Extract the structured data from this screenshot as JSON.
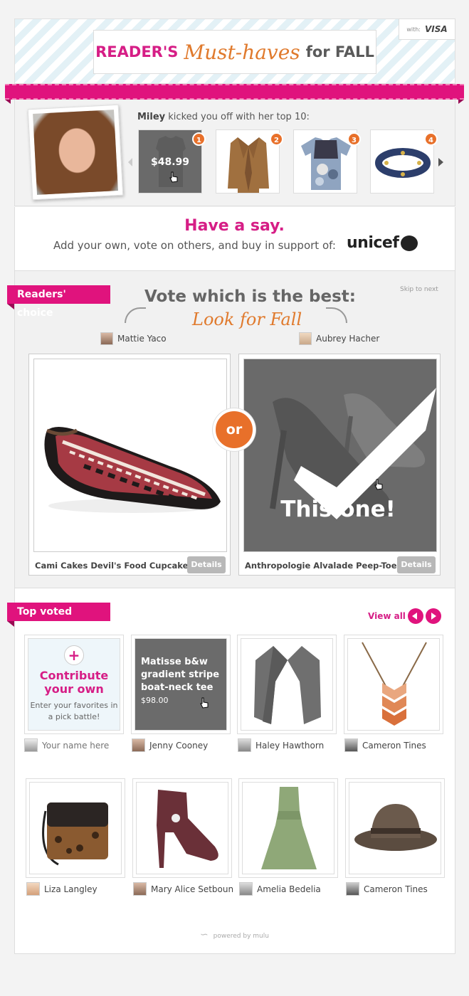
{
  "header": {
    "title_part1": "READER'S",
    "title_part2": "Must-haves",
    "title_part3": "for FALL",
    "sponsor_with": "with:",
    "sponsor_name": "VISA"
  },
  "celebrity": {
    "name": "Miley",
    "caption_rest": "kicked you off with her top 10:",
    "items": [
      {
        "rank": "1",
        "price": "$48.99"
      },
      {
        "rank": "2"
      },
      {
        "rank": "3"
      },
      {
        "rank": "4"
      }
    ]
  },
  "say": {
    "title": "Have a say.",
    "subtitle": "Add your own, vote on others, and buy in support of:",
    "charity": "unicef"
  },
  "vote": {
    "tag": "Readers' choice",
    "title": "Vote which is the best:",
    "subtitle": "Look for Fall",
    "skip": "Skip to next",
    "or": "or",
    "left": {
      "voter": "Mattie Yaco",
      "name": "Cami Cakes Devil's Food Cupcake...",
      "details": "Details"
    },
    "right": {
      "voter": "Aubrey Hacher",
      "name": "Anthropologie Alvalade Peep-Toe",
      "details": "Details",
      "overlay": "This one!"
    }
  },
  "top_voted": {
    "tag": "Top voted",
    "view_all": "View all",
    "contribute": {
      "title": "Contribute your own",
      "text": "Enter your favorites in a pick battle!",
      "name_placeholder": "Your name here"
    },
    "matisse": {
      "title": "Matisse b&w gradient stripe boat-neck tee",
      "price": "$98.00"
    },
    "row1_people": [
      "Jenny Cooney",
      "Haley Hawthorn",
      "Cameron Tines"
    ],
    "row2_people": [
      "Liza Langley",
      "Mary Alice Setboun",
      "Amelia Bedelia",
      "Cameron Tines"
    ]
  },
  "footer": {
    "powered": "powered by mulu"
  },
  "colors": {
    "pink": "#e0137d",
    "orange": "#e8702a"
  }
}
